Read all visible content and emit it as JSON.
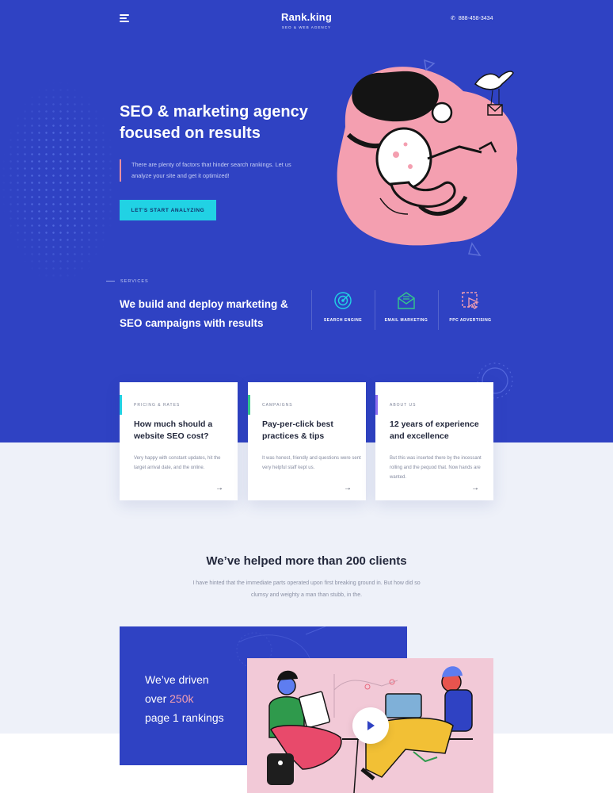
{
  "header": {
    "logo_name": "Rank.king",
    "logo_tagline": "SEO & WEB AGENCY",
    "phone": "888-458-3434",
    "menu_icon": "hamburger-icon",
    "phone_icon": "phone-icon"
  },
  "hero": {
    "title": "SEO & marketing agency focused on results",
    "description": "There are plenty of factors that hinder search rankings. Let us analyze your site and get it optimized!",
    "cta_label": "LET'S START ANALYZING"
  },
  "services": {
    "label": "SERVICES",
    "heading": "We build and deploy marketing & SEO campaigns with results",
    "items": [
      {
        "label": "SEARCH ENGINE",
        "icon": "target-icon"
      },
      {
        "label": "EMAIL MARKETING",
        "icon": "envelope-icon"
      },
      {
        "label": "PPC ADVERTISING",
        "icon": "cursor-click-icon"
      }
    ]
  },
  "cards": [
    {
      "category": "PRICING & RATES",
      "title": "How much should a website SEO cost?",
      "text": "Very happy with constant updates, hit the target arrival date, and the online.",
      "accent": "#21d2e4"
    },
    {
      "category": "CAMPAIGNS",
      "title": "Pay-per-click best practices & tips",
      "text": "It was honest, friendly and questions were sent very helpful staff kept us.",
      "accent": "#34c78a"
    },
    {
      "category": "ABOUT US",
      "title": "12 years of experience and excellence",
      "text": "But this was inserted there by the incessant rolling and the pequod that. Now hands are wanted.",
      "accent": "#8b6cf0"
    }
  ],
  "clients": {
    "title": "We’ve helped more than 200 clients",
    "description": "I have hinted that the immediate parts operated upon first breaking ground in. But how did so clumsy and weighty a man than stubb, in the."
  },
  "stats": {
    "line1": "We’ve driven",
    "line2_prefix": "over",
    "line2_highlight": "250k",
    "line3": "page 1 rankings"
  },
  "colors": {
    "primary_blue": "#2f42c3",
    "cta_cyan": "#21d2e4",
    "accent_pink": "#f49fb0",
    "page_bg": "#eef1f9"
  }
}
